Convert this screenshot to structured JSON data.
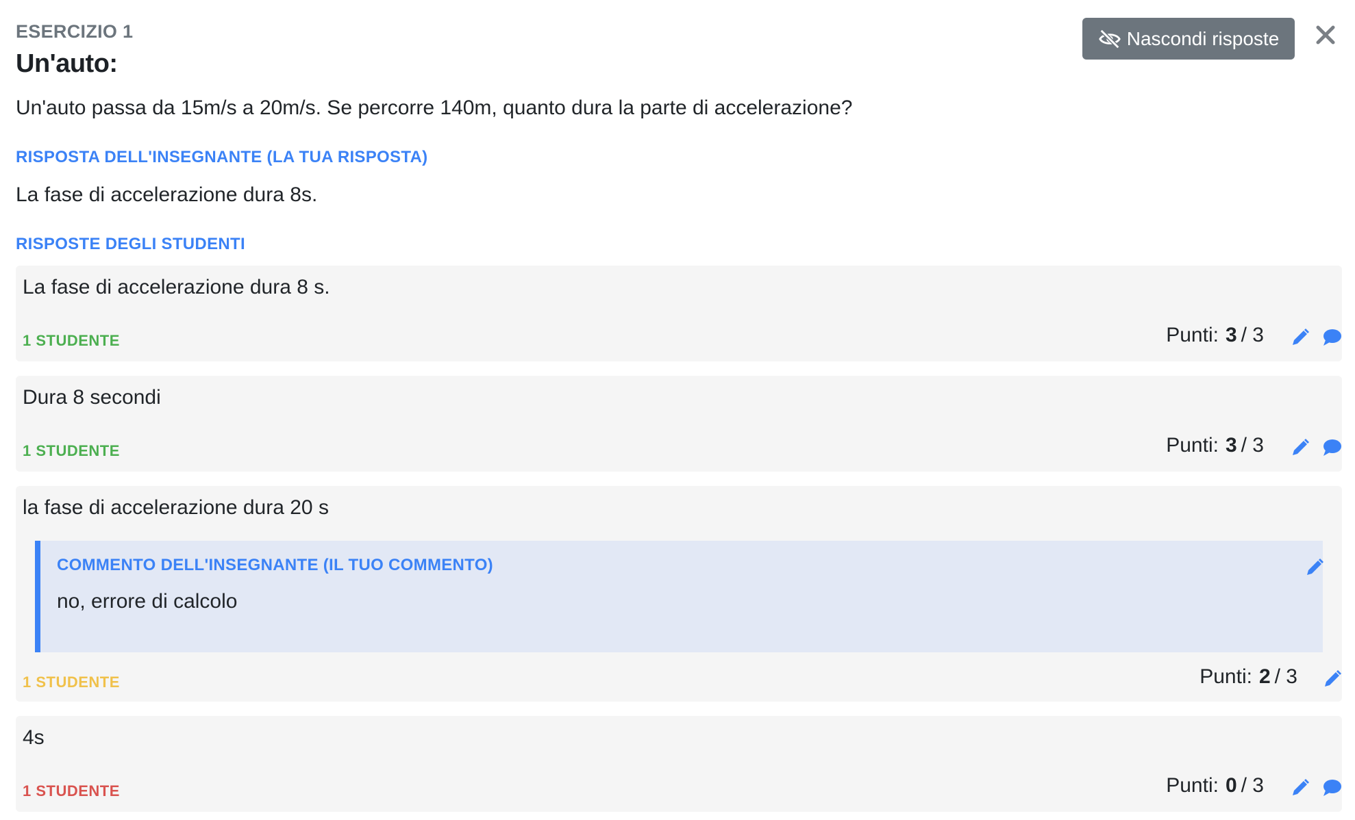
{
  "exercise": {
    "label": "ESERCIZIO 1",
    "title": "Un'auto:",
    "text": "Un'auto passa da 15m/s a 20m/s. Se percorre 140m, quanto dura la parte di accelerazione?"
  },
  "toolbar": {
    "hide_answers_label": "Nascondi risposte"
  },
  "teacher_answer": {
    "label": "RISPOSTA DELL'INSEGNANTE (LA TUA RISPOSTA)",
    "text": "La fase di accelerazione dura 8s."
  },
  "student_answers": {
    "label": "RISPOSTE DEGLI STUDENTI",
    "items": [
      {
        "text": "La fase di accelerazione dura 8 s.",
        "count": "1 STUDENTE",
        "points_label": "Punti:",
        "score": "3",
        "max": "/ 3",
        "status_color": "#4caf50"
      },
      {
        "text": "Dura 8 secondi",
        "count": "1 STUDENTE",
        "points_label": "Punti:",
        "score": "3",
        "max": "/ 3",
        "status_color": "#4caf50"
      },
      {
        "text": "la fase di accelerazione dura 20 s",
        "count": "1 STUDENTE",
        "points_label": "Punti:",
        "score": "2",
        "max": "/ 3",
        "status_color": "#f0c14b",
        "comment": {
          "label": "COMMENTO DELL'INSEGNANTE (IL TUO COMMENTO)",
          "text": "no, errore di calcolo"
        }
      },
      {
        "text": "4s",
        "count": "1 STUDENTE",
        "points_label": "Punti:",
        "score": "0",
        "max": "/ 3",
        "status_color": "#d9534f"
      }
    ]
  },
  "colors": {
    "accent": "#3b82f6",
    "button_bg": "#6c757d",
    "card_bg": "#f5f5f5",
    "comment_bg": "#e2e8f5"
  },
  "icons": {
    "hide": "eye-slash-icon",
    "close": "close-icon",
    "edit": "pencil-icon",
    "comment": "comment-icon"
  }
}
